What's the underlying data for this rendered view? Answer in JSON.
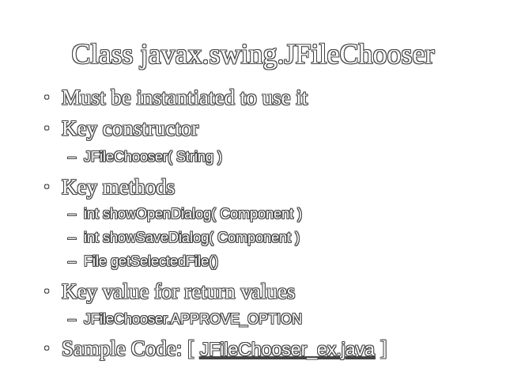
{
  "slide": {
    "title": "Class javax.swing.JFileChooser",
    "bullets": [
      {
        "text": "Must be instantiated to use it",
        "subs": []
      },
      {
        "text": "Key constructor",
        "subs": [
          "JFileChooser( String )"
        ]
      },
      {
        "text": "Key methods",
        "subs": [
          "int showOpenDialog( Component )",
          "int showSaveDialog( Component )",
          "File getSelectedFile()"
        ]
      },
      {
        "text": "Key value for return values",
        "subs": [
          "JFileChooser.APPROVE_OPTION"
        ]
      }
    ],
    "sample": {
      "prefix": "Sample Code: [ ",
      "link": "JFileChooser_ex.java",
      "suffix": " ]"
    },
    "bullet_glyph": "•",
    "dash_glyph": "–"
  }
}
